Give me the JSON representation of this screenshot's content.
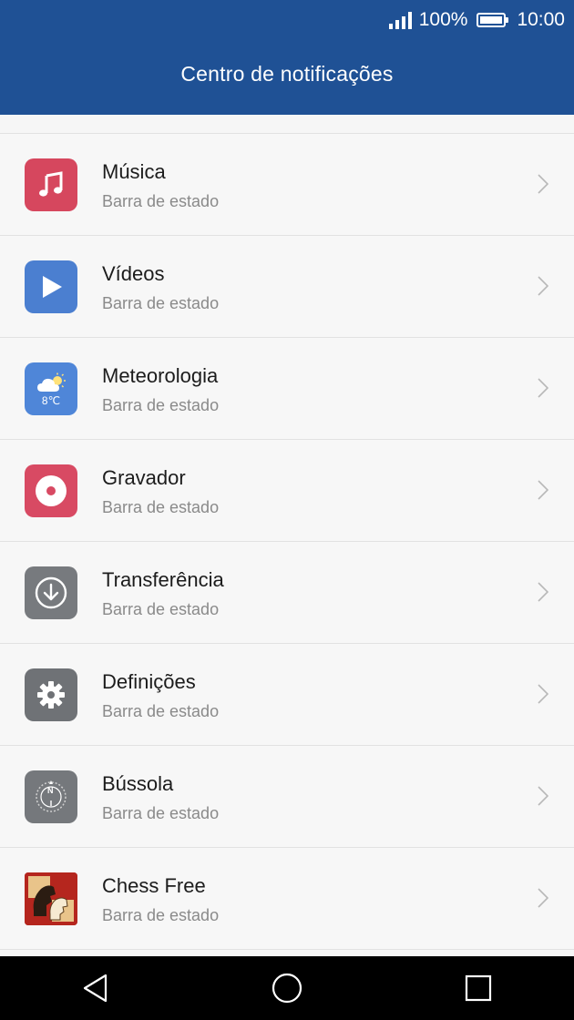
{
  "status_bar": {
    "battery": "100%",
    "time": "10:00"
  },
  "header": {
    "title": "Centro de notificações"
  },
  "apps": [
    {
      "name": "Música",
      "subtitle": "Barra de estado",
      "icon": "music-icon",
      "color": "#d6475e"
    },
    {
      "name": "Vídeos",
      "subtitle": "Barra de estado",
      "icon": "video-play-icon",
      "color": "#4b7fd0"
    },
    {
      "name": "Meteorologia",
      "subtitle": "Barra de estado",
      "icon": "weather-icon",
      "color": "#4f86d8",
      "icon_text": "8℃"
    },
    {
      "name": "Gravador",
      "subtitle": "Barra de estado",
      "icon": "recorder-icon",
      "color": "#d84a63"
    },
    {
      "name": "Transferência",
      "subtitle": "Barra de estado",
      "icon": "download-icon",
      "color": "#777a7e"
    },
    {
      "name": "Definições",
      "subtitle": "Barra de estado",
      "icon": "gear-icon",
      "color": "#6f7276"
    },
    {
      "name": "Bússola",
      "subtitle": "Barra de estado",
      "icon": "compass-icon",
      "color": "#75787c",
      "icon_text": "N"
    },
    {
      "name": "Chess Free",
      "subtitle": "Barra de estado",
      "icon": "chess-knight-icon",
      "color": "#b5261e"
    }
  ],
  "navbar": {
    "back": "back-icon",
    "home": "home-icon",
    "recents": "recents-icon"
  }
}
